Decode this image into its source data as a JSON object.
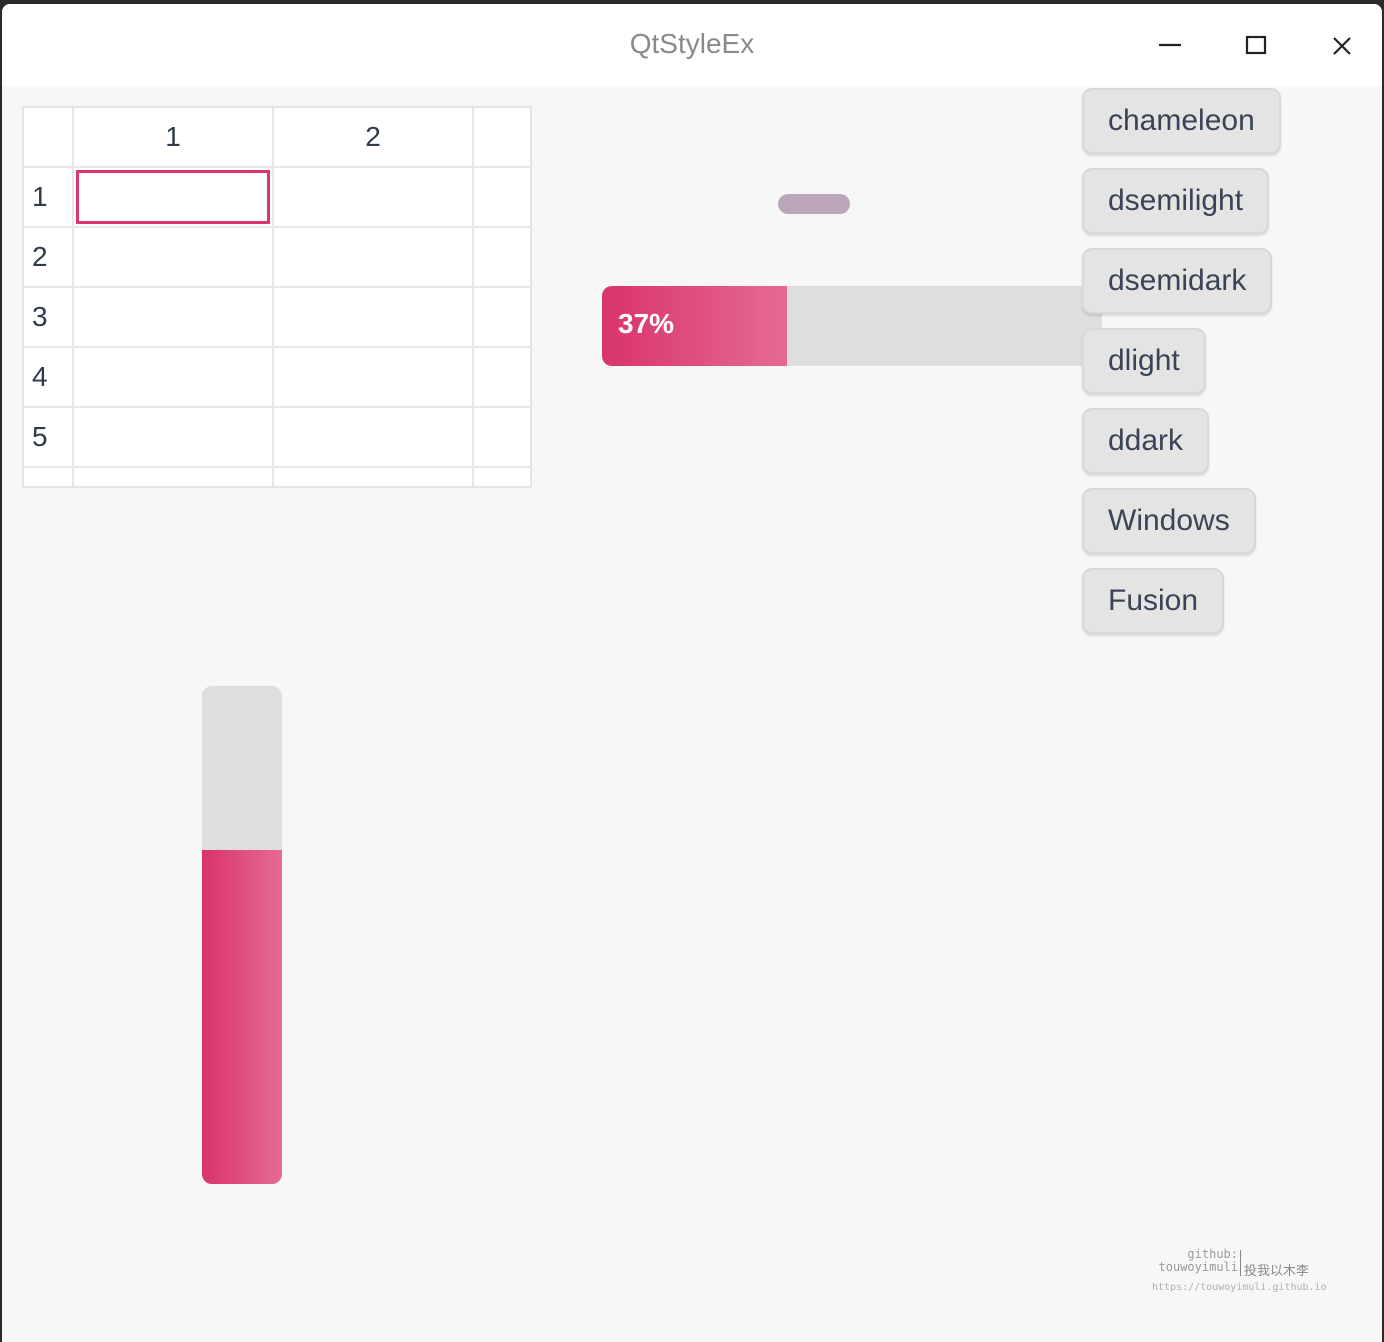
{
  "window": {
    "title": "QtStyleEx"
  },
  "titlebar_buttons": {
    "minimize_icon": "minimize-icon",
    "maximize_icon": "maximize-icon",
    "close_icon": "close-icon"
  },
  "table": {
    "column_headers": [
      "1",
      "2"
    ],
    "row_headers": [
      "1",
      "2",
      "3",
      "4",
      "5"
    ],
    "rows": [
      [
        "",
        ""
      ],
      [
        "",
        ""
      ],
      [
        "",
        ""
      ],
      [
        "",
        ""
      ],
      [
        "",
        ""
      ]
    ],
    "selected_cell": {
      "row": 1,
      "column": 1
    }
  },
  "horizontal_progress": {
    "value_percent": 37,
    "label": "37%"
  },
  "vertical_progress": {
    "value_percent": 67
  },
  "style_buttons": [
    {
      "label": "chameleon"
    },
    {
      "label": "dsemilight"
    },
    {
      "label": "dsemidark"
    },
    {
      "label": "dlight"
    },
    {
      "label": "ddark"
    },
    {
      "label": "Windows"
    },
    {
      "label": "Fusion"
    }
  ],
  "watermark": {
    "line1": "github:",
    "line2": "touwoyimuli",
    "chinese": "投我以木李",
    "url": "https://touwoyimuli.github.io"
  },
  "colors": {
    "accent": "#d9336c",
    "accent_light": "#e56a94",
    "track": "#dedede",
    "slider_handle": "#bba6bc",
    "window_bg": "#f7f7f7"
  }
}
